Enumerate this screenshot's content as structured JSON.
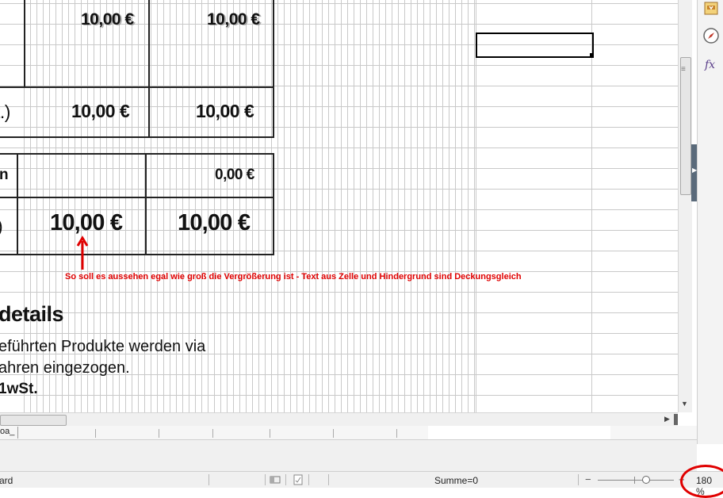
{
  "sheet": {
    "cells": {
      "r1c1": "10,00 €",
      "r1c2": "10,00 €",
      "r2c0": "t.)",
      "r2c1": "10,00 €",
      "r2c2": "10,00 €",
      "r3c0": "n",
      "r3c2": "0,00 €",
      "r4c0": ")",
      "r4c1": "10,00 €",
      "r4c2": "10,00 €"
    },
    "annotation": "So soll es aussehen egal wie groß die Vergrößerung ist - Text aus Zelle und Hindergrund sind Deckungsgleich",
    "details_heading": "details",
    "details_line1": "eführten Produkte werden via",
    "details_line2": "ahren eingezogen.",
    "details_line3": "1wSt."
  },
  "sheet_tabs": {
    "first": "oa_"
  },
  "statusbar": {
    "mode": "ard",
    "sum": "Summe=0",
    "zoom": "180 %",
    "zoom_minus": "−",
    "zoom_plus": "+"
  },
  "sidebar": {
    "icons": [
      "gallery-icon",
      "navigator-icon",
      "functions-icon"
    ]
  },
  "colors": {
    "annotation": "#e00000",
    "grid": "#c9c9c9",
    "border": "#222222"
  }
}
